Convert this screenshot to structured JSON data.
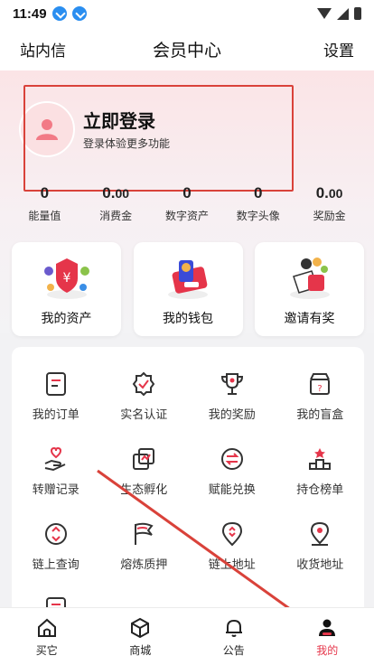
{
  "status": {
    "time": "11:49"
  },
  "header": {
    "left": "站内信",
    "title": "会员中心",
    "right": "设置"
  },
  "login": {
    "title": "立即登录",
    "subtitle": "登录体验更多功能"
  },
  "stats": [
    {
      "int": "0",
      "dec": "",
      "label": "能量值"
    },
    {
      "int": "0.",
      "dec": "00",
      "label": "消费金"
    },
    {
      "int": "0",
      "dec": "",
      "label": "数字资产"
    },
    {
      "int": "0",
      "dec": "",
      "label": "数字头像"
    },
    {
      "int": "0.",
      "dec": "00",
      "label": "奖励金"
    }
  ],
  "quick": [
    {
      "label": "我的资产",
      "icon": "assets-icon"
    },
    {
      "label": "我的钱包",
      "icon": "wallet-icon"
    },
    {
      "label": "邀请有奖",
      "icon": "invite-gift-icon"
    }
  ],
  "grid": [
    {
      "label": "我的订单",
      "icon": "order-icon"
    },
    {
      "label": "实名认证",
      "icon": "verify-badge-icon"
    },
    {
      "label": "我的奖励",
      "icon": "trophy-icon"
    },
    {
      "label": "我的盲盒",
      "icon": "mystery-box-icon"
    },
    {
      "label": "转赠记录",
      "icon": "gift-hand-icon"
    },
    {
      "label": "生态孵化",
      "icon": "incubate-icon"
    },
    {
      "label": "赋能兑换",
      "icon": "exchange-icon"
    },
    {
      "label": "持仓榜单",
      "icon": "podium-icon"
    },
    {
      "label": "链上查询",
      "icon": "chain-search-icon"
    },
    {
      "label": "熔炼质押",
      "icon": "flag-icon"
    },
    {
      "label": "链上地址",
      "icon": "chain-address-icon"
    },
    {
      "label": "收货地址",
      "icon": "location-pin-icon"
    }
  ],
  "tabs": [
    {
      "label": "买它",
      "icon": "home-icon"
    },
    {
      "label": "商城",
      "icon": "cube-icon"
    },
    {
      "label": "公告",
      "icon": "bell-icon"
    },
    {
      "label": "我的",
      "icon": "user-icon"
    }
  ],
  "colors": {
    "accent": "#e5354a",
    "annotation": "#d9423a"
  }
}
